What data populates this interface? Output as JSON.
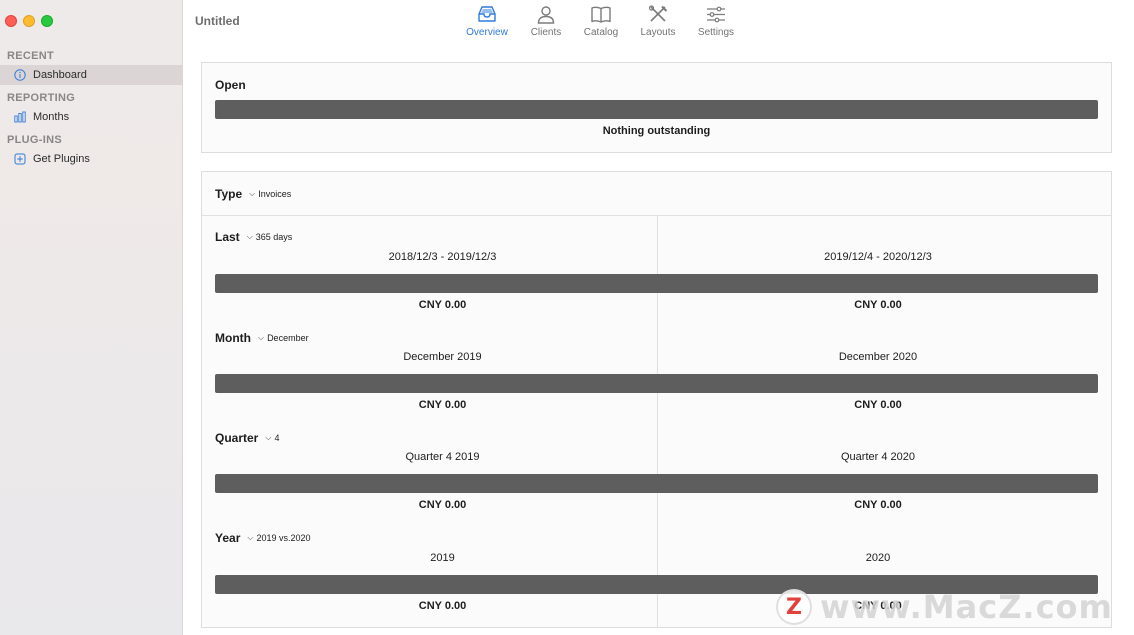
{
  "window": {
    "title": "Untitled"
  },
  "sidebar": {
    "sections": [
      {
        "heading": "RECENT",
        "items": [
          {
            "label": "Dashboard",
            "icon": "info-icon",
            "selected": true
          }
        ]
      },
      {
        "heading": "REPORTING",
        "items": [
          {
            "label": "Months",
            "icon": "bar-chart-icon"
          }
        ]
      },
      {
        "heading": "PLUG-INS",
        "items": [
          {
            "label": "Get Plugins",
            "icon": "plus-square-icon"
          }
        ]
      }
    ]
  },
  "toolbar": {
    "tabs": [
      {
        "label": "Overview",
        "icon": "tray-icon",
        "active": true
      },
      {
        "label": "Clients",
        "icon": "person-icon"
      },
      {
        "label": "Catalog",
        "icon": "book-icon"
      },
      {
        "label": "Layouts",
        "icon": "tools-icon"
      },
      {
        "label": "Settings",
        "icon": "sliders-icon"
      }
    ],
    "active_color": "#2f7bd8"
  },
  "open_panel": {
    "title": "Open",
    "status": "Nothing outstanding"
  },
  "type_panel": {
    "label": "Type",
    "value": "Invoices",
    "rows": [
      {
        "label": "Last",
        "value": "365 days",
        "left_period": "2018/12/3 - 2019/12/3",
        "right_period": "2019/12/4 - 2020/12/3",
        "left_amount": "CNY 0.00",
        "right_amount": "CNY 0.00"
      },
      {
        "label": "Month",
        "value": "December",
        "left_period": "December 2019",
        "right_period": "December 2020",
        "left_amount": "CNY 0.00",
        "right_amount": "CNY 0.00"
      },
      {
        "label": "Quarter",
        "value": "4",
        "left_period": "Quarter 4 2019",
        "right_period": "Quarter 4 2020",
        "left_amount": "CNY 0.00",
        "right_amount": "CNY 0.00"
      },
      {
        "label": "Year",
        "value": "2019 vs.2020",
        "left_period": "2019",
        "right_period": "2020",
        "left_amount": "CNY 0.00",
        "right_amount": "CNY 0.00"
      }
    ]
  },
  "watermark": {
    "badge": "Z",
    "text": "www.MacZ.com"
  }
}
